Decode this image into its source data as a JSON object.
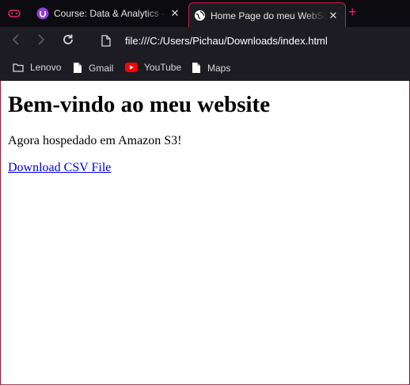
{
  "tabs": [
    {
      "title": "Course: Data & Analytics - I",
      "icon": "course-icon"
    },
    {
      "title": "Home Page do meu WebSite",
      "icon": "globe-icon"
    }
  ],
  "toolbar": {
    "url": "file:///C:/Users/Pichau/Downloads/index.html"
  },
  "bookmarks": [
    {
      "label": "Lenovo",
      "icon": "folder-icon"
    },
    {
      "label": "Gmail",
      "icon": "page-icon"
    },
    {
      "label": "YouTube",
      "icon": "youtube-icon"
    },
    {
      "label": "Maps",
      "icon": "page-icon"
    }
  ],
  "page": {
    "heading": "Bem-vindo ao meu website",
    "text": "Agora hospedado em Amazon S3!",
    "link": "Download CSV File"
  },
  "colors": {
    "accent": "#e0245e",
    "link": "#0000ee",
    "toolbar_bg": "#1d1c22"
  }
}
